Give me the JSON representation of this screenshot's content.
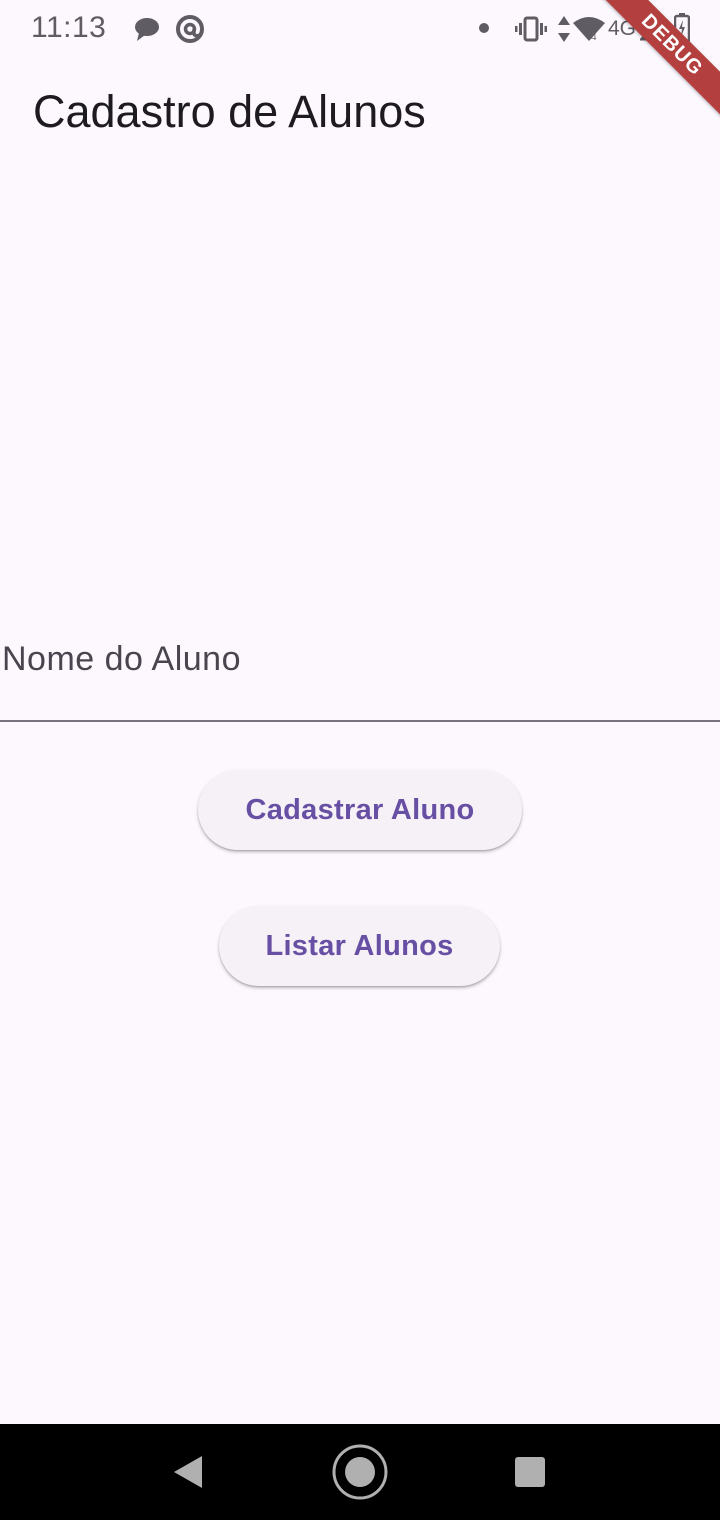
{
  "status_bar": {
    "time": "11:13",
    "network": "4G",
    "icons": [
      "chat-bubble-icon",
      "at-sign-icon",
      "dot-icon",
      "vibrate-icon",
      "data-arrows-icon",
      "wifi-icon",
      "signal-icon",
      "battery-icon"
    ]
  },
  "debug_banner": "DEBUG",
  "app_bar": {
    "title": "Cadastro de Alunos"
  },
  "form": {
    "name_field": {
      "label": "Nome do Aluno",
      "value": ""
    }
  },
  "actions": {
    "register_label": "Cadastrar Aluno",
    "list_label": "Listar Alunos"
  },
  "nav_bar": {
    "icons": [
      "back-icon",
      "home-icon",
      "recents-icon"
    ]
  },
  "colors": {
    "background": "#fdf7fe",
    "primary": "#6750a4",
    "button_surface": "#f6f1f7",
    "debug_ribbon": "#b3403e",
    "nav_bar": "#000000"
  }
}
